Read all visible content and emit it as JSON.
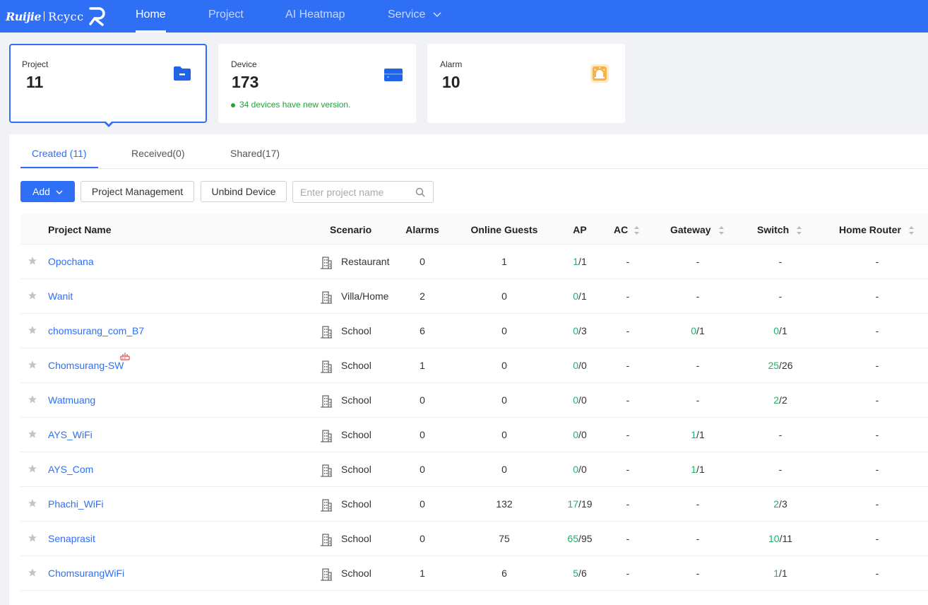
{
  "nav": {
    "logo_brand": "Ruijie",
    "logo_sub": "Rcycc",
    "items": [
      {
        "label": "Home",
        "active": true
      },
      {
        "label": "Project",
        "active": false
      },
      {
        "label": "AI Heatmap",
        "active": false
      },
      {
        "label": "Service",
        "active": false
      }
    ]
  },
  "cards": [
    {
      "label": "Project",
      "count": "11",
      "icon": "folder-icon",
      "selected": true
    },
    {
      "label": "Device",
      "count": "173",
      "note": "34 devices have new version.",
      "icon": "device-icon"
    },
    {
      "label": "Alarm",
      "count": "10",
      "icon": "alarm-icon"
    }
  ],
  "tabs": [
    {
      "label": "Created (11)",
      "active": true
    },
    {
      "label": "Received(0)"
    },
    {
      "label": "Shared(17)"
    }
  ],
  "toolbar": {
    "add_label": "Add",
    "project_management_label": "Project Management",
    "unbind_device_label": "Unbind Device",
    "search_placeholder": "Enter project name"
  },
  "table": {
    "columns": {
      "name": "Project Name",
      "scenario": "Scenario",
      "alarms": "Alarms",
      "guests": "Online Guests",
      "ap": "AP",
      "ac": "AC",
      "gateway": "Gateway",
      "switch": "Switch",
      "home_router": "Home Router"
    },
    "rows": [
      {
        "name": "Opochana",
        "scenario": "Restaurant",
        "alarms": "0",
        "guests": "1",
        "ap_on": "1",
        "ap_total": "/1",
        "ac": "-",
        "gw_on": "",
        "gw_total": "-",
        "sw_on": "",
        "sw_total": "-",
        "router": "-"
      },
      {
        "name": "Wanit",
        "scenario": "Villa/Home",
        "alarms": "2",
        "guests": "0",
        "ap_on": "0",
        "ap_total": "/1",
        "ac": "-",
        "gw_on": "",
        "gw_total": "-",
        "sw_on": "",
        "sw_total": "-",
        "router": "-"
      },
      {
        "name": "chomsurang_com_B7",
        "scenario": "School",
        "alarms": "6",
        "guests": "0",
        "ap_on": "0",
        "ap_total": "/3",
        "ac": "-",
        "gw_on": "0",
        "gw_total": "/1",
        "sw_on": "0",
        "sw_total": "/1",
        "router": "-"
      },
      {
        "name": "Chomsurang-SW",
        "scenario": "School",
        "alarms": "1",
        "guests": "0",
        "ap_on": "0",
        "ap_total": "/0",
        "ac": "-",
        "gw_on": "",
        "gw_total": "-",
        "sw_on": "25",
        "sw_total": "/26",
        "router": "-",
        "badge": "router-alert-icon"
      },
      {
        "name": "Watmuang",
        "scenario": "School",
        "alarms": "0",
        "guests": "0",
        "ap_on": "0",
        "ap_total": "/0",
        "ac": "-",
        "gw_on": "",
        "gw_total": "-",
        "sw_on": "2",
        "sw_total": "/2",
        "router": "-"
      },
      {
        "name": "AYS_WiFi",
        "scenario": "School",
        "alarms": "0",
        "guests": "0",
        "ap_on": "0",
        "ap_total": "/0",
        "ac": "-",
        "gw_on": "1",
        "gw_total": "/1",
        "sw_on": "",
        "sw_total": "-",
        "router": "-"
      },
      {
        "name": "AYS_Com",
        "scenario": "School",
        "alarms": "0",
        "guests": "0",
        "ap_on": "0",
        "ap_total": "/0",
        "ac": "-",
        "gw_on": "1",
        "gw_total": "/1",
        "sw_on": "",
        "sw_total": "-",
        "router": "-"
      },
      {
        "name": "Phachi_WiFi",
        "scenario": "School",
        "alarms": "0",
        "guests": "132",
        "ap_on": "17",
        "ap_total": "/19",
        "ac": "-",
        "gw_on": "",
        "gw_total": "-",
        "sw_on": "2",
        "sw_total": "/3",
        "router": "-"
      },
      {
        "name": "Senaprasit",
        "scenario": "School",
        "alarms": "0",
        "guests": "75",
        "ap_on": "65",
        "ap_total": "/95",
        "ac": "-",
        "gw_on": "",
        "gw_total": "-",
        "sw_on": "10",
        "sw_total": "/11",
        "router": "-"
      },
      {
        "name": "ChomsurangWiFi",
        "scenario": "School",
        "alarms": "1",
        "guests": "6",
        "ap_on": "5",
        "ap_total": "/6",
        "ac": "-",
        "gw_on": "",
        "gw_total": "-",
        "sw_on": "1",
        "sw_total": "/1",
        "router": "-"
      }
    ]
  },
  "colors": {
    "primary": "#2f6ff5",
    "online": "#20b26b",
    "alarm_badge": "#e5484d"
  }
}
